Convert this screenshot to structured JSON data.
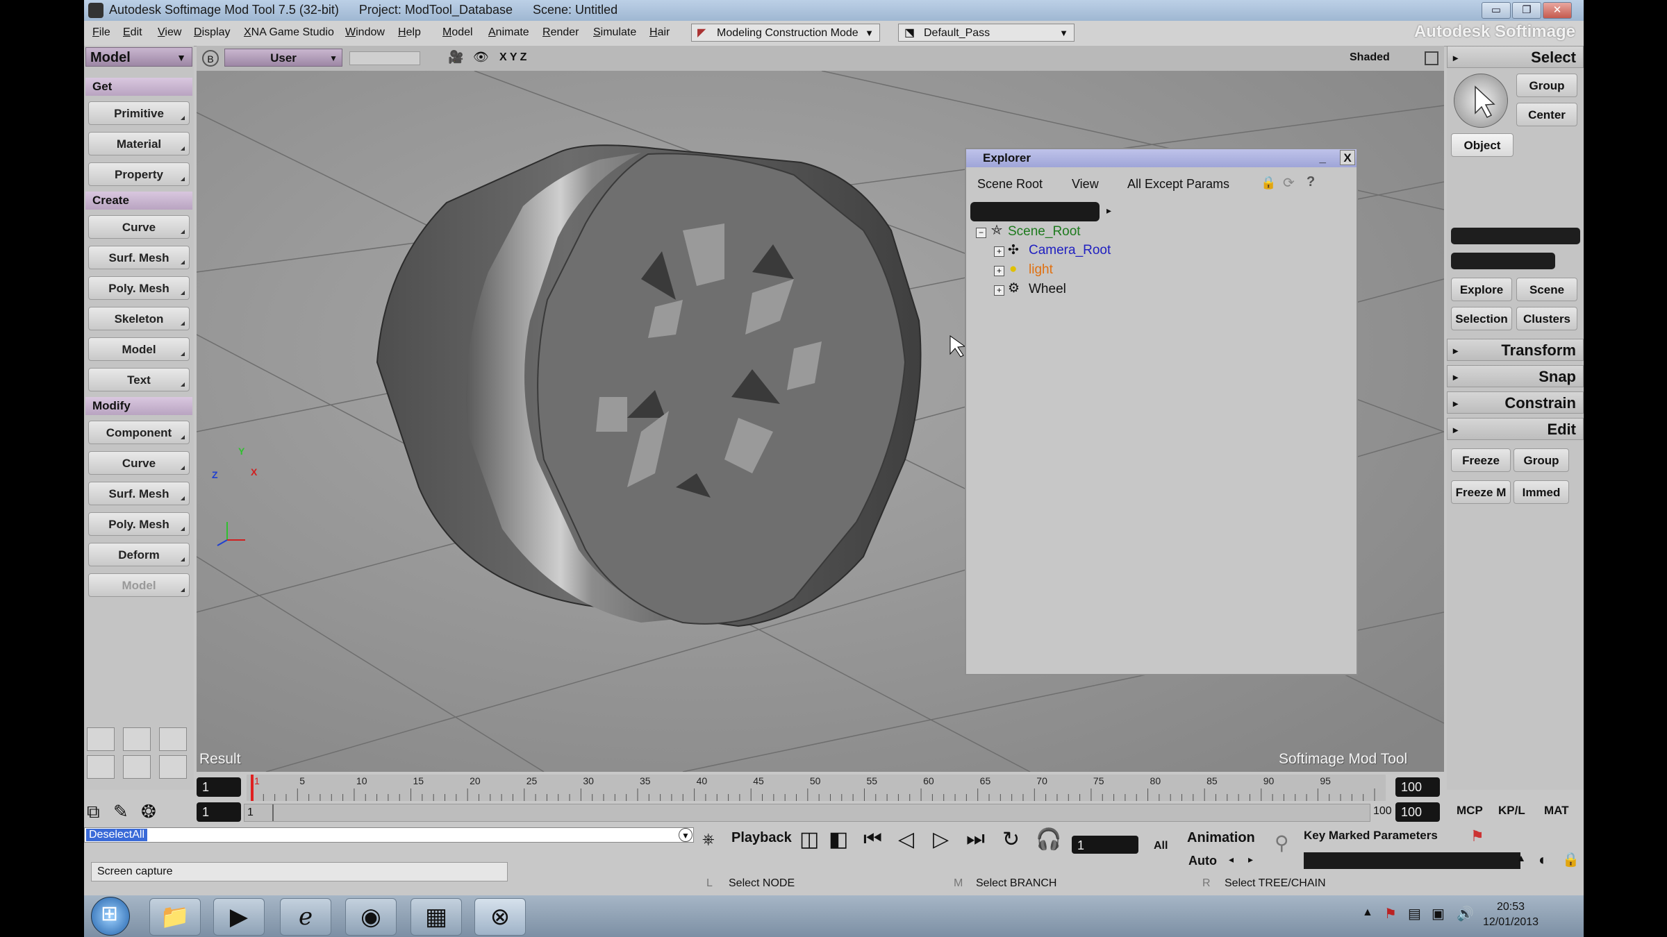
{
  "window": {
    "app_title": "Autodesk Softimage Mod Tool 7.5 (32-bit)",
    "project": "Project: ModTool_Database",
    "scene": "Scene: Untitled",
    "brand": "Autodesk Softimage",
    "min": "▭",
    "max": "❐",
    "close": "✕"
  },
  "menubar": {
    "items": [
      "File",
      "Edit",
      "View",
      "Display",
      "XNA Game Studio",
      "Window",
      "Help",
      "Model",
      "Animate",
      "Render",
      "Simulate",
      "Hair"
    ],
    "mode_dropdown": "Modeling Construction Mode",
    "pass_dropdown": "Default_Pass"
  },
  "left_toolbar": {
    "mode": "Model",
    "get_header": "Get",
    "get_items": [
      "Primitive",
      "Material",
      "Property"
    ],
    "create_header": "Create",
    "create_items": [
      "Curve",
      "Surf. Mesh",
      "Poly. Mesh",
      "Skeleton",
      "Model",
      "Text"
    ],
    "modify_header": "Modify",
    "modify_items": [
      "Component",
      "Curve",
      "Surf. Mesh",
      "Poly. Mesh",
      "Deform",
      "Model"
    ]
  },
  "viewport": {
    "view_menu": "User",
    "axes_label": "X Y Z",
    "shading": "Shaded",
    "result_label": "Result",
    "watermark": "Softimage Mod Tool",
    "axis_y": "Y",
    "axis_x": "X",
    "axis_z": "Z"
  },
  "explorer": {
    "title": "Explorer",
    "tabs": [
      "Scene Root",
      "View",
      "All Except Params"
    ],
    "help": "?",
    "tree": [
      {
        "label": "Scene_Root",
        "color": "#1e7a1e"
      },
      {
        "label": "Camera_Root",
        "color": "#2020c0"
      },
      {
        "label": "light",
        "color": "#e07010"
      },
      {
        "label": "Wheel",
        "color": "#111111"
      }
    ]
  },
  "right_panel": {
    "select_header": "Select",
    "group": "Group",
    "center": "Center",
    "object": "Object",
    "explore": "Explore",
    "scene": "Scene",
    "selection": "Selection",
    "clusters": "Clusters",
    "transform": "Transform",
    "snap": "Snap",
    "constrain": "Constrain",
    "edit": "Edit",
    "freeze": "Freeze",
    "edit_group": "Group",
    "freeze_m": "Freeze M",
    "immed": "Immed"
  },
  "timeline": {
    "start": "1",
    "end": "100",
    "ticks": [
      "1",
      "5",
      "10",
      "15",
      "20",
      "25",
      "30",
      "35",
      "40",
      "45",
      "50",
      "55",
      "60",
      "65",
      "70",
      "75",
      "80",
      "85",
      "90",
      "95"
    ],
    "range_start": "1",
    "range_start2": "1",
    "range_end_label": "100",
    "range_end": "100",
    "current_frame": 1
  },
  "command": {
    "text": "DeselectAll",
    "playback": "Playback",
    "frame": "1",
    "all": "All",
    "animation": "Animation",
    "auto": "Auto",
    "key_marked": "Key Marked Parameters",
    "mcp": "MCP",
    "kpl": "KP/L",
    "mat": "MAT"
  },
  "status": {
    "message": "Screen capture",
    "l_key": "L",
    "l_text": "Select NODE",
    "m_key": "M",
    "m_text": "Select BRANCH",
    "r_key": "R",
    "r_text": "Select TREE/CHAIN"
  },
  "taskbar": {
    "time": "20:53",
    "date": "12/01/2013"
  }
}
